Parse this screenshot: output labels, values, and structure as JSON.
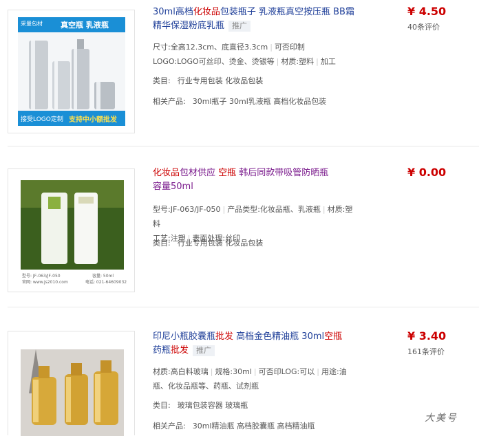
{
  "listings": [
    {
      "title": {
        "prefix": "30ml高档",
        "kw1": "化妆品",
        "rest": "包装瓶子 乳液瓶真空按压瓶 BB霜精华保湿粉底乳瓶"
      },
      "promo": "推广",
      "price": "¥ 4.50",
      "reviews": "40条评价",
      "attrs": [
        "尺寸:全高12.3cm、底直径3.3cm",
        "可否印制",
        "LOGO:LOGO可丝印、烫金、烫银等",
        "材质:塑料",
        "加工"
      ],
      "category_label": "类目:",
      "category_value": "行业专用包装 化妆品包装",
      "related_label": "相关产品:",
      "related_value": "30ml瓶子 30ml乳液瓶 高档化妆品包装",
      "image": {
        "banner_brand": "采量包材",
        "banner_top": "真空瓶 乳液瓶",
        "banner_bottom_left": "接受LOGO定制",
        "banner_bottom_right": "支持中小额批发"
      }
    },
    {
      "title": {
        "kw1": "化妆品",
        "mid1": "包材供应 ",
        "kw2": "空瓶",
        "mid2": " 韩后同款带吸管防晒瓶",
        "tail": "容量50ml"
      },
      "price": "¥ 0.00",
      "attrs": [
        "型号:JF-063/JF-050",
        "产品类型:化妆品瓶、乳液瓶",
        "材质:塑料",
        "工艺:注塑",
        "表面处理:丝印"
      ],
      "category_label": "类目:",
      "category_value": "行业专用包装 化妆品包装",
      "image": {
        "caption1": "型号: JF-063/JF-050",
        "caption1b": "容量: 50ml",
        "caption2": "官网: www.js2010.com",
        "caption2b": "电话: 021-64609032"
      }
    },
    {
      "title": {
        "prefix": "印尼小瓶胶囊瓶",
        "kw1": "批发",
        "mid1": " 高档金色精油瓶 30ml",
        "kw2": "空瓶",
        "line2": "药瓶",
        "kw3": "批发"
      },
      "promo": "推广",
      "price": "¥ 3.40",
      "reviews": "161条评价",
      "attrs": [
        "材质:高白料玻璃",
        "规格:30ml",
        "可否印LOG:可以",
        "用途:油瓶、化妆品瓶等、药瓶、试剂瓶"
      ],
      "category_label": "类目:",
      "category_value": "玻璃包装容器 玻璃瓶",
      "related_label": "相关产品:",
      "related_value": "30ml精油瓶 高档胶囊瓶 高档精油瓶"
    }
  ],
  "watermark": "大美号"
}
